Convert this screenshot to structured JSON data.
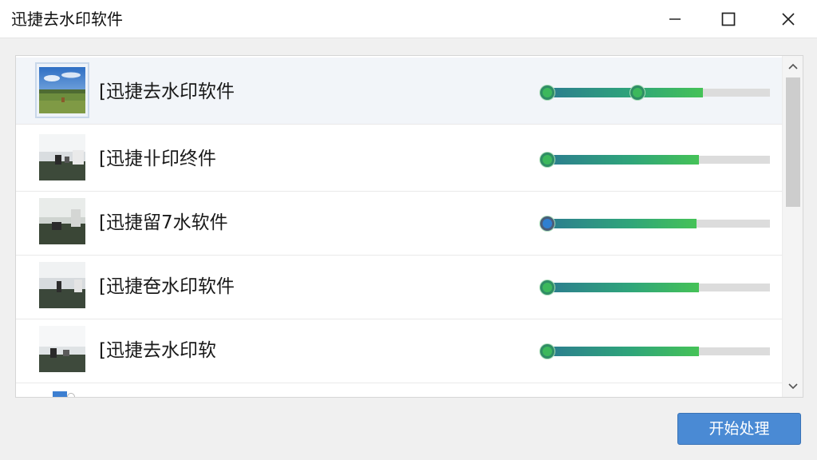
{
  "window": {
    "title": "迅捷去水印软件",
    "minimize_icon": "minimize-icon",
    "maximize_icon": "maximize-icon",
    "close_icon": "close-icon"
  },
  "list": {
    "items": [
      {
        "name": "[迅捷去水印软件",
        "thumbnail_icon": "landscape-photo-icon",
        "progress": 0.7,
        "selected": true,
        "handle_count": 2
      },
      {
        "name": "[迅捷卝印终件",
        "thumbnail_icon": "room-photo-icon",
        "progress": 0.68,
        "selected": false,
        "handle_count": 1
      },
      {
        "name": "[迅捷留7水软件",
        "thumbnail_icon": "room-photo-icon",
        "progress": 0.67,
        "selected": false,
        "handle_count": 1
      },
      {
        "name": "[迅捷夿水印软件",
        "thumbnail_icon": "room-photo-icon",
        "progress": 0.68,
        "selected": false,
        "handle_count": 1
      },
      {
        "name": "[迅捷去水印软",
        "thumbnail_icon": "room-photo-icon",
        "progress": 0.68,
        "selected": false,
        "handle_count": 1
      }
    ]
  },
  "scrollbar": {
    "up_icon": "chevron-up-icon",
    "down_icon": "chevron-down-icon"
  },
  "actions": {
    "start_label": "开始处理"
  },
  "colors": {
    "accent_blue": "#4a8ad4",
    "progress_start": "#2c7d8f",
    "progress_end": "#45c257",
    "track": "#dcdcdc"
  }
}
